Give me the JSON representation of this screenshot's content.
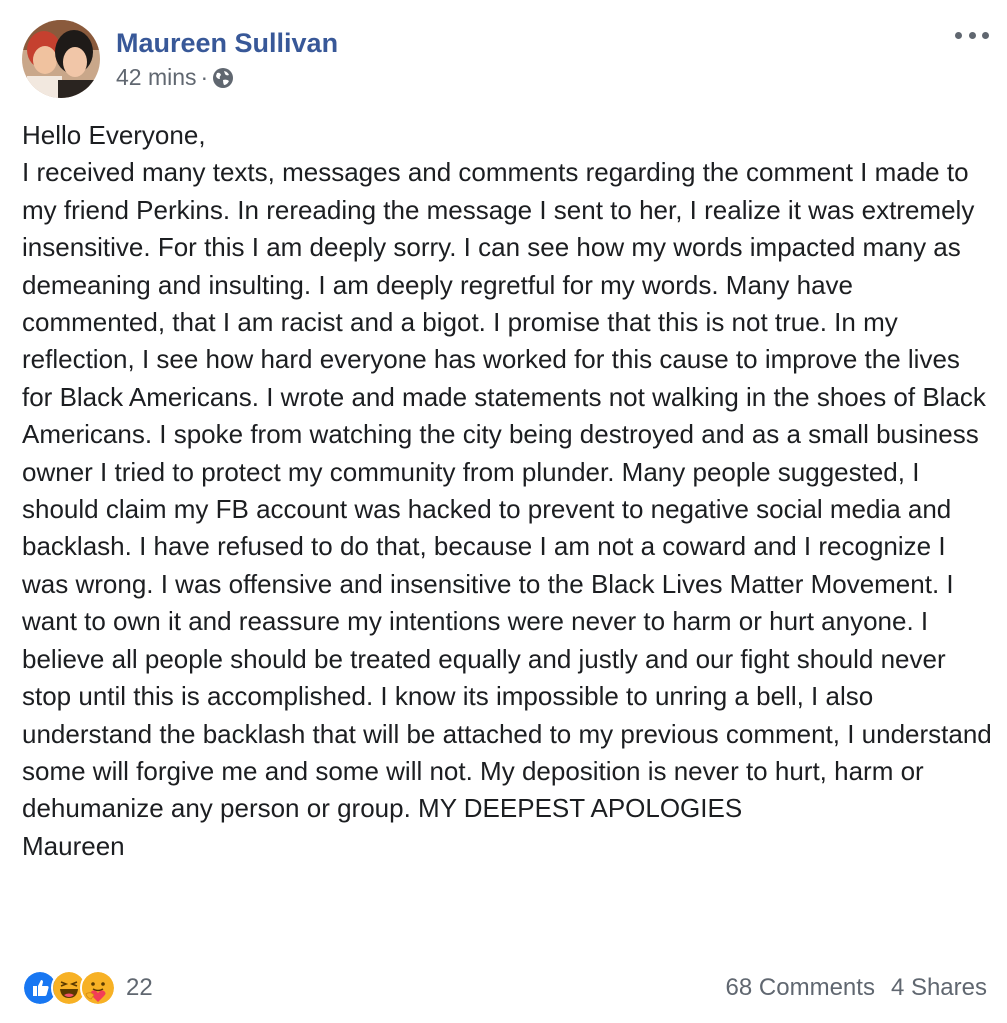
{
  "post": {
    "author": "Maureen Sullivan",
    "timestamp": "42 mins",
    "separator": "·",
    "privacy_icon": "globe-icon",
    "more_icon": "more-options-icon",
    "body_lines": [
      "Hello Everyone,",
      "I received many texts, messages and comments regarding the comment I made to my friend Perkins. In rereading the message I sent to her, I realize it was extremely insensitive. For this I am deeply sorry. I can see how my words impacted many as demeaning and insulting. I am deeply regretful for my words. Many have commented, that I am racist and a bigot. I promise that this is not true. In my reflection, I see how hard everyone has worked for this cause to improve the lives for Black Americans. I wrote and made statements not walking in the shoes of Black Americans. I spoke from watching the city being destroyed and as a small business owner I tried to protect my community from plunder. Many people suggested, I should claim my FB account was hacked to prevent to negative social media and backlash. I have refused to do that, because I am not a coward and I recognize I was wrong. I was offensive and insensitive to the Black Lives Matter Movement. I want to own it and reassure my intentions were never to harm or hurt anyone. I believe all people should be treated equally and justly and our fight should never stop until this is accomplished. I know its impossible to unring a bell, I also understand the backlash that will be attached to my previous comment, I understand some will forgive me and some will not. My deposition is never to hurt, harm or dehumanize any person or group. MY DEEPEST APOLOGIES",
      "Maureen"
    ]
  },
  "footer": {
    "reactions": [
      "like-reaction-icon",
      "haha-reaction-icon",
      "care-reaction-icon"
    ],
    "reaction_count": "22",
    "comments": "68 Comments",
    "shares": "4 Shares"
  },
  "colors": {
    "author": "#385898",
    "secondary_text": "#606770",
    "body_text": "#1c1e21",
    "like_blue": "#1877f2",
    "reaction_yellow": "#f7b125"
  }
}
